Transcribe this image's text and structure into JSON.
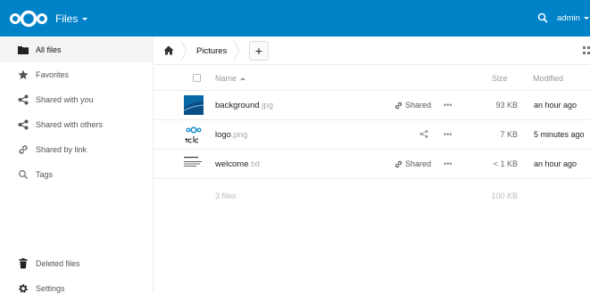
{
  "header": {
    "app_name": "Files",
    "user_name": "admin",
    "brand_color": "#0082c9"
  },
  "sidebar": {
    "items": [
      {
        "label": "All files",
        "icon": "folder-icon",
        "active": true
      },
      {
        "label": "Favorites",
        "icon": "star-icon"
      },
      {
        "label": "Shared with you",
        "icon": "share-icon"
      },
      {
        "label": "Shared with others",
        "icon": "share-icon"
      },
      {
        "label": "Shared by link",
        "icon": "link-icon"
      },
      {
        "label": "Tags",
        "icon": "tag-icon"
      }
    ],
    "bottom": [
      {
        "label": "Deleted files",
        "icon": "trash-icon"
      },
      {
        "label": "Settings",
        "icon": "gear-icon"
      }
    ]
  },
  "breadcrumb": {
    "current": "Pictures",
    "add_label": "+"
  },
  "table": {
    "columns": {
      "name": "Name",
      "size": "Size",
      "modified": "Modified"
    },
    "rows": [
      {
        "base": "background",
        "ext": ".jpg",
        "shared": "Shared",
        "size": "93 KB",
        "modified": "an hour ago"
      },
      {
        "base": "logo",
        "ext": ".png",
        "shared": "",
        "size": "7 KB",
        "modified": "5 minutes ago"
      },
      {
        "base": "welcome",
        "ext": ".txt",
        "shared": "Shared",
        "size": "< 1 KB",
        "modified": "an hour ago"
      }
    ],
    "summary": {
      "count": "3 files",
      "size": "100 KB"
    }
  }
}
